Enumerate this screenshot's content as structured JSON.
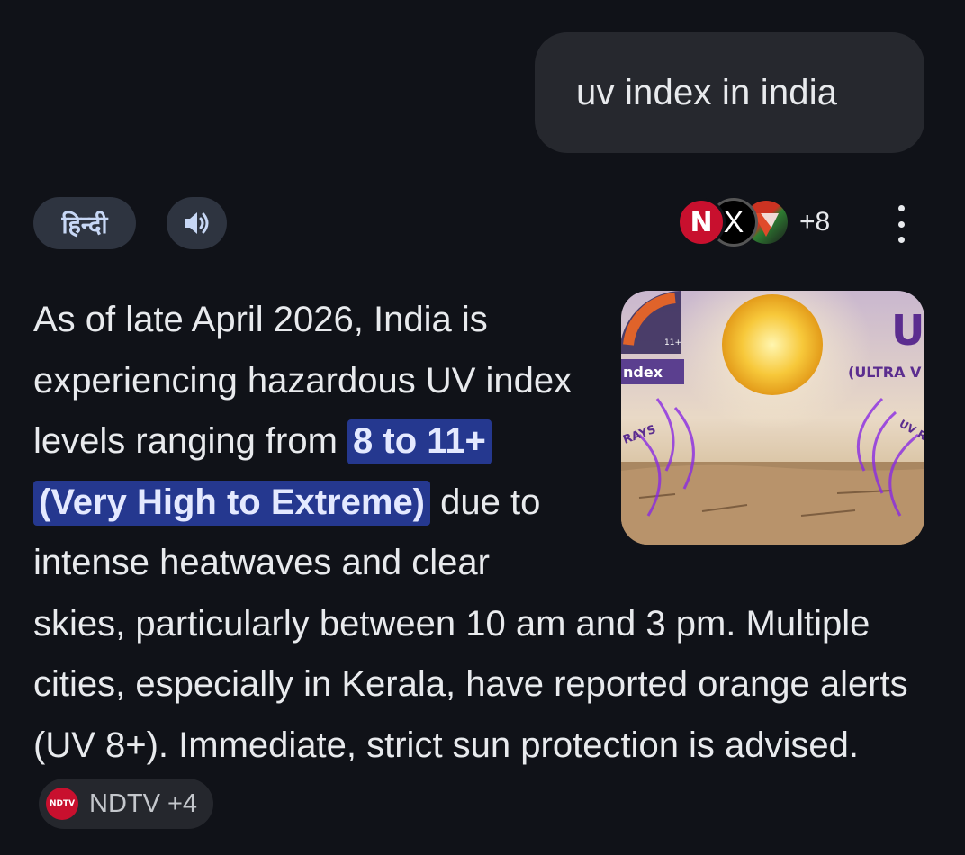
{
  "query": {
    "text": "uv index in india"
  },
  "toolbar": {
    "language_label": "हिन्दी",
    "speak_icon": "speaker-icon",
    "sources_more": "+8",
    "more_icon": "more-vert-icon"
  },
  "sources": [
    {
      "name": "NDTV",
      "glyph": "N"
    },
    {
      "name": "X",
      "glyph": "X"
    },
    {
      "name": "source-3",
      "glyph": ""
    }
  ],
  "thumbnail": {
    "big_letter": "U",
    "caption_1": "(ULTRA V",
    "caption_2": "ndex",
    "rays_left": "RAYS",
    "rays_right": "UV R",
    "scale_top": "11+"
  },
  "answer": {
    "part1": "As of late April 2026, India is experiencing hazardous UV index levels ranging from ",
    "highlight": "8 to 11+ (Very High to Extreme)",
    "part2": " due to intense heatwaves and clear skies, particularly between 10 am and 3 pm. Multiple cities, especially in Kerala, have reported orange alerts (UV 8+). Immediate, strict sun protection is advised.",
    "citation": {
      "icon_text": "NDTV",
      "label": "NDTV +4"
    }
  },
  "colors": {
    "background": "#101218",
    "bubble": "#26282e",
    "chip": "#2e3440",
    "highlight": "#25388f",
    "ndtv_red": "#c8102e"
  }
}
